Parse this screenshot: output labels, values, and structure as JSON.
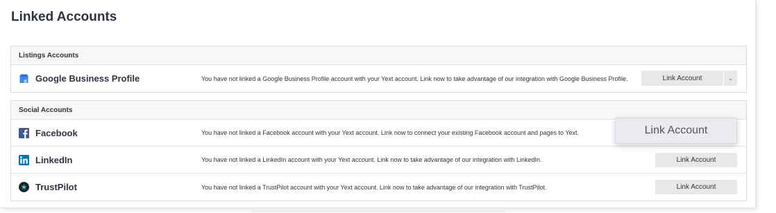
{
  "page": {
    "title": "Linked Accounts"
  },
  "listings": {
    "header": "Listings Accounts",
    "rows": [
      {
        "name": "Google Business Profile",
        "icon": "google-business-profile-icon",
        "description": "You have not linked a Google Business Profile account with your Yext account. Link now to take advantage of our integration with Google Business Profile.",
        "button": "Link Account",
        "caret": "⌄"
      }
    ]
  },
  "social": {
    "header": "Social Accounts",
    "rows": [
      {
        "name": "Facebook",
        "icon": "facebook-icon",
        "description": "You have not linked a Facebook account with your Yext account. Link now to connect your existing Facebook account and pages to Yext."
      },
      {
        "name": "LinkedIn",
        "icon": "linkedin-icon",
        "description": "You have not linked a LinkedIn account with your Yext account. Link now to take advantage of our integration with LinkedIn.",
        "button": "Link Account"
      },
      {
        "name": "TrustPilot",
        "icon": "trustpilot-icon",
        "description": "You have not linked a TrustPilot account with your Yext account. Link now to take advantage of our integration with TrustPilot.",
        "button": "Link Account"
      }
    ]
  },
  "popup": {
    "label": "Link Account"
  },
  "colors": {
    "google_blue": "#4285f4",
    "facebook_blue": "#3b5998",
    "linkedin_blue": "#0077b5",
    "trustpilot_dark": "#1c2430",
    "button_bg": "#e8e8e8"
  }
}
